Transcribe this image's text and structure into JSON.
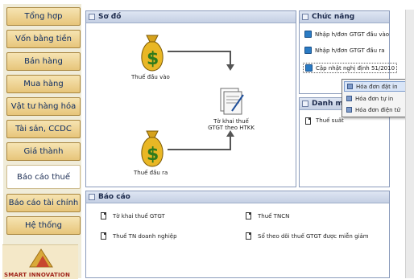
{
  "sidebar": {
    "items": [
      {
        "label": "Tổng hợp"
      },
      {
        "label": "Vốn bằng tiền"
      },
      {
        "label": "Bán hàng"
      },
      {
        "label": "Mua hàng"
      },
      {
        "label": "Vật tư hàng hóa"
      },
      {
        "label": "Tài sản, CCDC"
      },
      {
        "label": "Giá thành"
      },
      {
        "label": "Báo cáo thuế"
      },
      {
        "label": "Báo cáo tài chính"
      },
      {
        "label": "Hệ thống"
      }
    ],
    "active_item": "Báo cáo thuế",
    "logo_text": "SMART INNOVATION"
  },
  "diagram": {
    "title": "Sơ đồ",
    "nodes": {
      "input_vat": "Thuế đầu vào",
      "output_vat": "Thuế đầu ra",
      "declaration": "Tờ khai thuế GTGT theo HTKK"
    }
  },
  "functions": {
    "title": "Chức năng",
    "items": [
      {
        "label": "Nhập h/đơn GTGT đầu vào"
      },
      {
        "label": "Nhập h/đơn GTGT đầu ra"
      },
      {
        "label": "Cập nhật nghị định 51/2010"
      }
    ]
  },
  "catalog": {
    "title": "Danh mục",
    "items": [
      {
        "label": "Thuế suất"
      }
    ]
  },
  "popup_menu": {
    "items": [
      {
        "label": "Hóa đơn đặt in",
        "selected": true
      },
      {
        "label": "Hóa đơn tự in",
        "selected": false
      },
      {
        "label": "Hóa đơn điện tử",
        "selected": false
      }
    ]
  },
  "reports": {
    "title": "Báo cáo",
    "items": [
      {
        "label": "Tờ khai thuế GTGT"
      },
      {
        "label": "Thuế TNCN"
      },
      {
        "label": "Thuế TN doanh nghiệp"
      },
      {
        "label": "Sổ theo dõi thuế GTGT được miễn giảm"
      }
    ]
  },
  "colors": {
    "panel_border": "#8a9bbb",
    "sidebar_button": "#e7c57a",
    "accent": "#2a7bc4"
  }
}
